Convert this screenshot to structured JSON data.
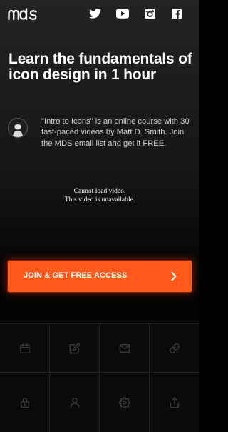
{
  "header": {
    "logo": "mds",
    "social": [
      {
        "icon": "twitter-icon"
      },
      {
        "icon": "youtube-icon"
      },
      {
        "icon": "instagram-icon"
      },
      {
        "icon": "facebook-icon"
      }
    ]
  },
  "hero": {
    "headline": "Learn the fundamentals of icon design in 1 hour",
    "intro": "\"Intro to Icons\" is an online course with 30 fast-paced videos by Matt D. Smith. Join the MDS email list and get it FREE."
  },
  "video": {
    "line1": "Cannot load video.",
    "line2": "This video is unavailable."
  },
  "cta": {
    "label": "JOIN & GET FREE ACCESS",
    "icon": "chevron-right-icon"
  },
  "icon_grid": [
    "calendar-icon",
    "edit-icon",
    "mail-icon",
    "link-icon",
    "lock-icon",
    "user-icon",
    "settings-icon",
    "share-icon"
  ],
  "colors": {
    "accent": "#ff5a1c",
    "background": "#000000",
    "grid_icon": "#3c3c3c"
  }
}
